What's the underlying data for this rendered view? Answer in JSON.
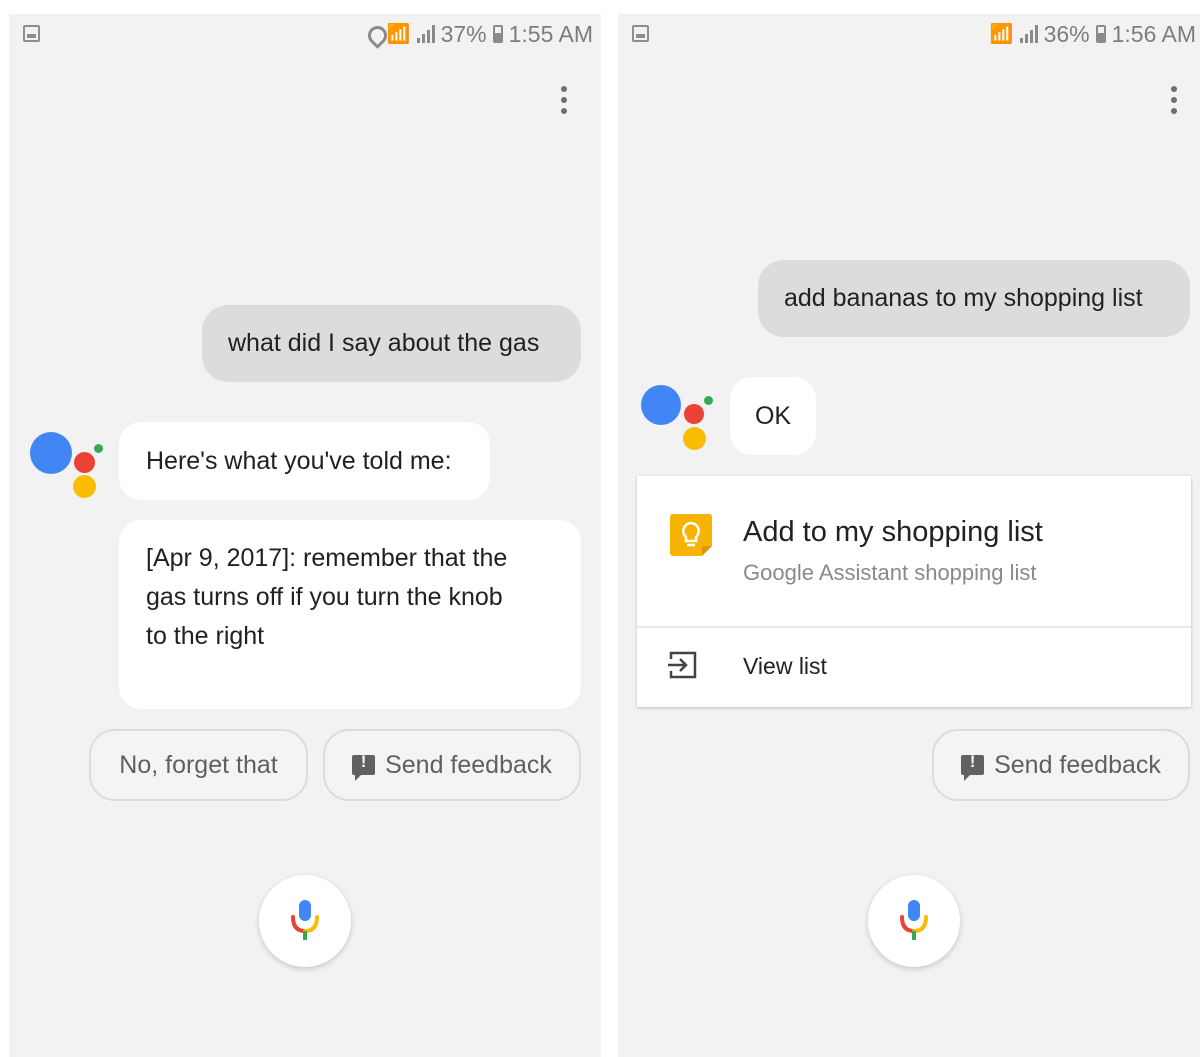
{
  "left_screen": {
    "status": {
      "battery": "37%",
      "time": "1:55 AM"
    },
    "user_query": "what did I say about the gas",
    "assistant_intro": "Here's what you've told me:",
    "memory_lines": [
      "[Apr 9, 2017]: remember that the",
      "gas turns off if you turn the knob",
      "to the right"
    ],
    "chips": {
      "forget": "No, forget that",
      "feedback": "Send feedback"
    }
  },
  "right_screen": {
    "status": {
      "battery": "36%",
      "time": "1:56 AM"
    },
    "user_query": "add bananas to my shopping list",
    "assistant_reply": "OK",
    "card": {
      "title": "Add to my shopping list",
      "subtitle": "Google Assistant shopping list",
      "action_label": "View list"
    },
    "chips": {
      "feedback": "Send feedback"
    }
  },
  "colors": {
    "assistant_blue": "#4285f4",
    "assistant_red": "#ea4335",
    "assistant_yellow": "#fbbc04",
    "assistant_green": "#34a853",
    "keep_yellow": "#f6b400"
  },
  "icons": [
    "screenshot-icon",
    "location-icon",
    "wifi-icon",
    "signal-icon",
    "battery-icon",
    "overflow-menu-icon",
    "assistant-logo",
    "feedback-icon",
    "microphone-icon",
    "lightbulb-icon",
    "open-in-icon"
  ]
}
